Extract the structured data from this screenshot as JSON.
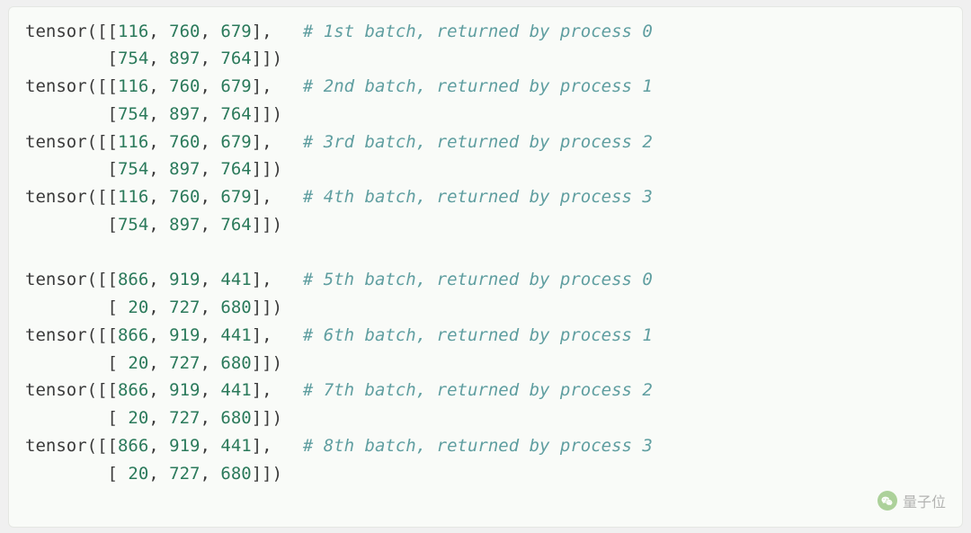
{
  "code": {
    "groups": [
      {
        "batches": [
          {
            "vals1": [
              116,
              760,
              679
            ],
            "vals2": [
              754,
              897,
              764
            ],
            "ord": "1st",
            "proc": 0
          },
          {
            "vals1": [
              116,
              760,
              679
            ],
            "vals2": [
              754,
              897,
              764
            ],
            "ord": "2nd",
            "proc": 1
          },
          {
            "vals1": [
              116,
              760,
              679
            ],
            "vals2": [
              754,
              897,
              764
            ],
            "ord": "3rd",
            "proc": 2
          },
          {
            "vals1": [
              116,
              760,
              679
            ],
            "vals2": [
              754,
              897,
              764
            ],
            "ord": "4th",
            "proc": 3
          }
        ]
      },
      {
        "batches": [
          {
            "vals1": [
              866,
              919,
              441
            ],
            "vals2": [
              20,
              727,
              680
            ],
            "ord": "5th",
            "proc": 0
          },
          {
            "vals1": [
              866,
              919,
              441
            ],
            "vals2": [
              20,
              727,
              680
            ],
            "ord": "6th",
            "proc": 1
          },
          {
            "vals1": [
              866,
              919,
              441
            ],
            "vals2": [
              20,
              727,
              680
            ],
            "ord": "7th",
            "proc": 2
          },
          {
            "vals1": [
              866,
              919,
              441
            ],
            "vals2": [
              20,
              727,
              680
            ],
            "ord": "8th",
            "proc": 3
          }
        ]
      }
    ],
    "prefix": "tensor",
    "comment_template": "# {ord} batch, returned by process {proc}",
    "indent": "        "
  },
  "watermark": {
    "text": "量子位"
  }
}
